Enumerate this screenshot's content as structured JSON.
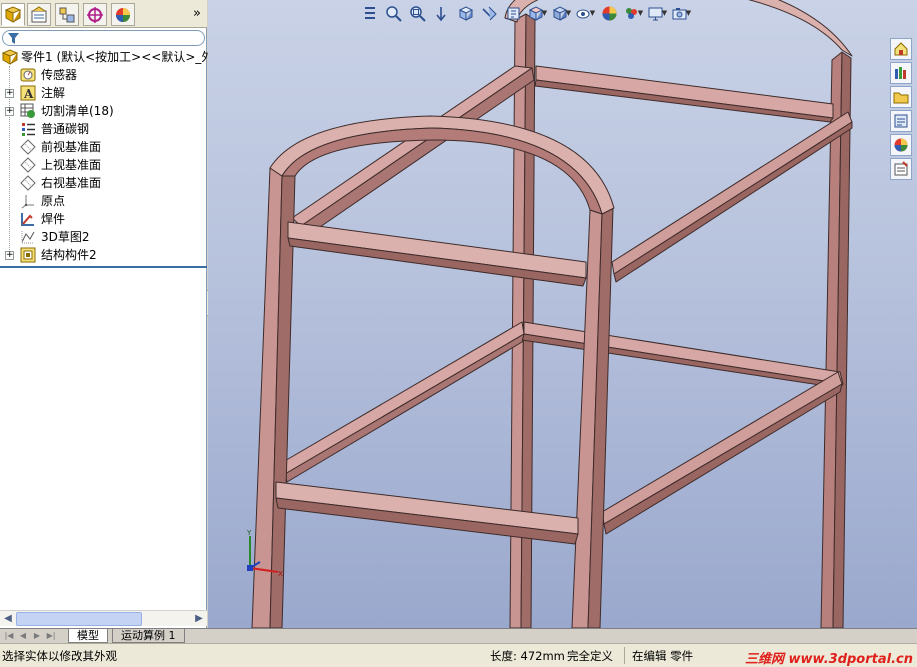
{
  "manager_tabs": [
    {
      "name": "featuremanager-tab",
      "icon": "feature-tree-icon"
    },
    {
      "name": "propertymanager-tab",
      "icon": "property-icon"
    },
    {
      "name": "configurationmanager-tab",
      "icon": "configuration-icon"
    },
    {
      "name": "dimxpert-tab",
      "icon": "crosshair-icon"
    },
    {
      "name": "display-manager-tab",
      "icon": "appearance-icon"
    }
  ],
  "expand_label": "»",
  "tree": {
    "root": "零件1  (默认<按加工><<默认>_外?",
    "items": [
      {
        "label": "传感器",
        "icon": "sensor-icon",
        "expandable": false
      },
      {
        "label": "注解",
        "icon": "annotation-icon",
        "expandable": true
      },
      {
        "label": "切割清单(18)",
        "icon": "cut-list-icon",
        "expandable": true
      },
      {
        "label": "普通碳钢",
        "icon": "material-icon",
        "expandable": false
      },
      {
        "label": "前视基准面",
        "icon": "plane-icon",
        "expandable": false
      },
      {
        "label": "上视基准面",
        "icon": "plane-icon",
        "expandable": false
      },
      {
        "label": "右视基准面",
        "icon": "plane-icon",
        "expandable": false
      },
      {
        "label": "原点",
        "icon": "origin-icon",
        "expandable": false
      },
      {
        "label": "焊件",
        "icon": "weldment-icon",
        "expandable": false
      },
      {
        "label": "3D草图2",
        "icon": "sketch-3d-icon",
        "expandable": false
      },
      {
        "label": "结构构件2",
        "icon": "structural-member-icon",
        "expandable": true
      }
    ]
  },
  "bottom_tabs": [
    "模型",
    "运动算例 1"
  ],
  "status": {
    "message": "选择实体以修改其外观",
    "length": "长度: 472mm",
    "definition": "完全定义",
    "editing": "在编辑 零件",
    "watermark": "三维网 www.3dportal.cn"
  },
  "colors": {
    "beam": "#c99592",
    "beam_light": "#dbb1ae",
    "beam_dark": "#8d5c59",
    "viewport_top": "#c9d2e6",
    "viewport_bottom": "#9aa8cd"
  }
}
